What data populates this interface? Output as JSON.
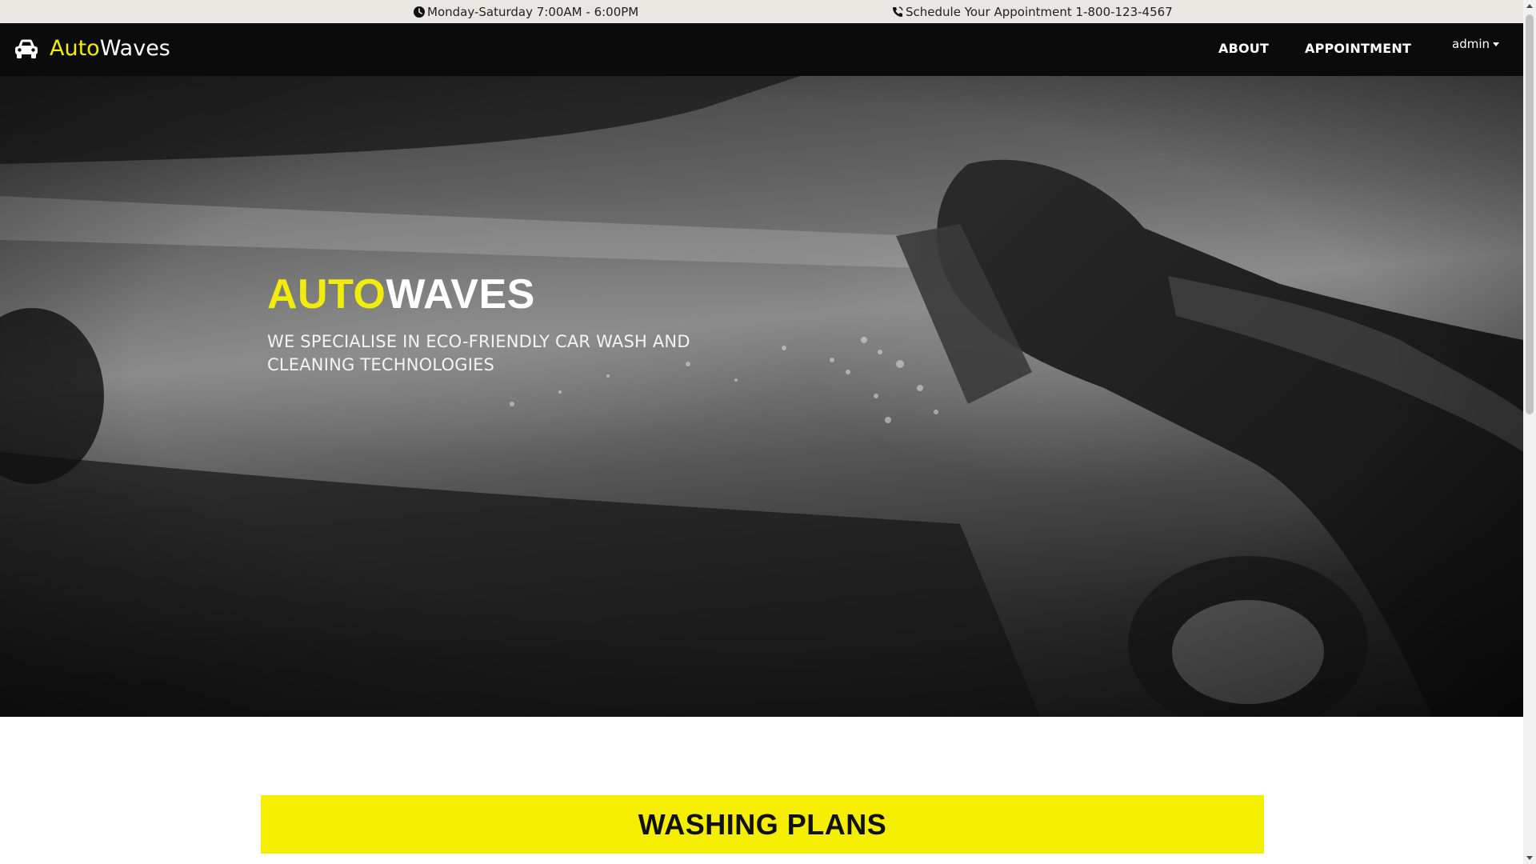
{
  "topbar": {
    "hours": "Monday-Saturday 7:00AM - 6:00PM",
    "hours_icon": "clock-icon",
    "phone": "Schedule Your Appointment 1-800-123-4567",
    "phone_icon": "phone-icon"
  },
  "navbar": {
    "brand_icon": "car-icon",
    "brand_part1": "Auto",
    "brand_part2": "Waves",
    "links": [
      {
        "label": "ABOUT"
      },
      {
        "label": "APPOINTMENT"
      }
    ],
    "user": "admin",
    "user_icon": "caret-down-icon"
  },
  "hero": {
    "title_part1": "AUTO",
    "title_part2": "WAVES",
    "subtitle": "WE SPECIALISE IN ECO-FRIENDLY CAR WASH AND CLEANING TECHNOLOGIES"
  },
  "plans": {
    "heading": "WASHING PLANS"
  },
  "colors": {
    "accent": "#f2ec0c",
    "navbar_bg": "#0c0b0b",
    "topbar_bg": "#e8e7e2",
    "plans_bg": "#f5ee00"
  }
}
